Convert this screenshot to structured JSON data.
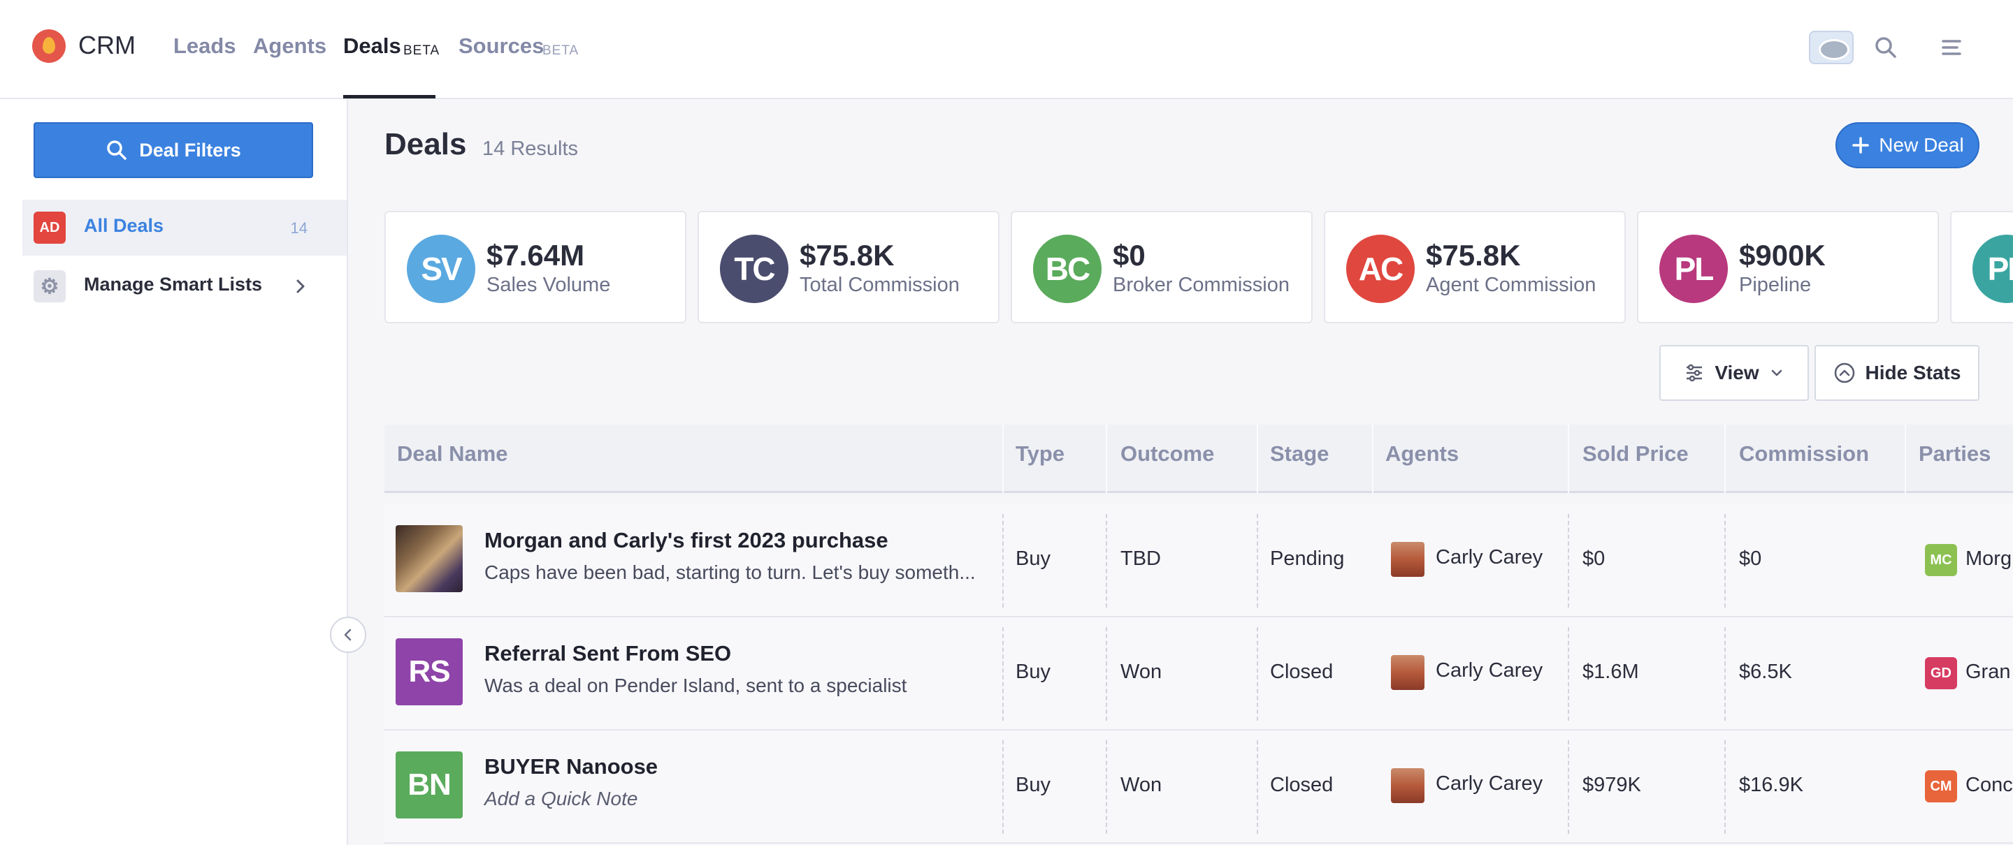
{
  "nav": {
    "brand": "CRM",
    "links": [
      {
        "label": "Leads"
      },
      {
        "label": "Agents"
      },
      {
        "label": "Deals",
        "badge": "BETA"
      },
      {
        "label": "Sources",
        "badge": "BETA"
      }
    ]
  },
  "sidebar": {
    "filters_label": "Deal Filters",
    "items": [
      {
        "badge": "AD",
        "label": "All Deals",
        "count": "14"
      },
      {
        "label": "Manage Smart Lists"
      }
    ]
  },
  "main": {
    "title": "Deals",
    "results": "14 Results",
    "new_deal": "New Deal",
    "view_label": "View",
    "hide_stats_label": "Hide Stats"
  },
  "stats": [
    {
      "initials": "SV",
      "value": "$7.64M",
      "label": "Sales Volume",
      "color": "#5aa9e0"
    },
    {
      "initials": "TC",
      "value": "$75.8K",
      "label": "Total Commission",
      "color": "#4a4d6e"
    },
    {
      "initials": "BC",
      "value": "$0",
      "label": "Broker Commission",
      "color": "#5aab5c"
    },
    {
      "initials": "AC",
      "value": "$75.8K",
      "label": "Agent Commission",
      "color": "#e0473f"
    },
    {
      "initials": "PL",
      "value": "$900K",
      "label": "Pipeline",
      "color": "#b8397d"
    },
    {
      "initials": "PL",
      "color": "#3aa5a0"
    }
  ],
  "table": {
    "headers": [
      "Deal Name",
      "Type",
      "Outcome",
      "Stage",
      "Agents",
      "Sold Price",
      "Commission",
      "Parties"
    ],
    "rows": [
      {
        "thumb": "photo",
        "title": "Morgan and Carly's first 2023 purchase",
        "note": "Caps have been bad, starting to turn. Let's buy someth...",
        "type": "Buy",
        "outcome": "TBD",
        "stage": "Pending",
        "agent": "Carly Carey",
        "sold_price": "$0",
        "commission": "$0",
        "party_badge": "MC",
        "party_color": "#8cc152",
        "party": "Morg"
      },
      {
        "thumb": "RS",
        "thumb_color": "#8e44a8",
        "title": "Referral Sent From SEO",
        "note": "Was a deal on Pender Island, sent to a specialist",
        "type": "Buy",
        "outcome": "Won",
        "stage": "Closed",
        "agent": "Carly Carey",
        "sold_price": "$1.6M",
        "commission": "$6.5K",
        "party_badge": "GD",
        "party_color": "#d63c62",
        "party": "Gran"
      },
      {
        "thumb": "BN",
        "thumb_color": "#5aab5c",
        "title": "BUYER Nanoose",
        "note": "Add a Quick Note",
        "note_italic": true,
        "type": "Buy",
        "outcome": "Won",
        "stage": "Closed",
        "agent": "Carly Carey",
        "sold_price": "$979K",
        "commission": "$16.9K",
        "party_badge": "CM",
        "party_color": "#e8643a",
        "party": "Conc"
      }
    ]
  }
}
